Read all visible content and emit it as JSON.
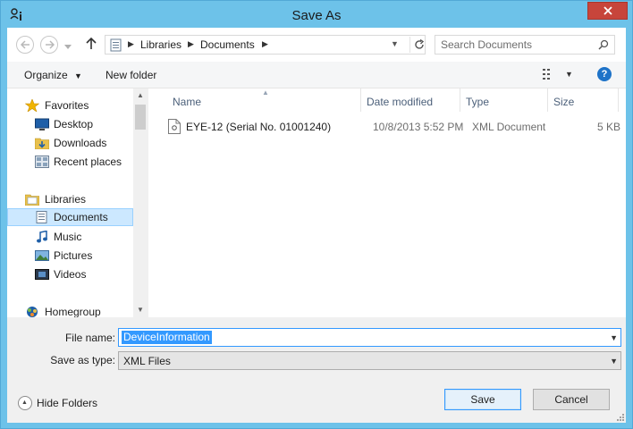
{
  "window": {
    "title": "Save As",
    "close_label": "×"
  },
  "nav": {
    "back": "back",
    "forward": "forward",
    "recent_dropdown": "recent-locations",
    "up": "up"
  },
  "address": {
    "crumbs": [
      "Libraries",
      "Documents"
    ]
  },
  "search": {
    "placeholder": "Search Documents"
  },
  "commandbar": {
    "organize_label": "Organize",
    "new_folder_label": "New folder"
  },
  "navpane": {
    "items": [
      {
        "label": "Favorites",
        "icon": "star-icon",
        "group": true
      },
      {
        "label": "Desktop",
        "icon": "desktop-icon"
      },
      {
        "label": "Downloads",
        "icon": "downloads-folder-icon"
      },
      {
        "label": "Recent places",
        "icon": "recent-places-icon"
      },
      {
        "label": "Libraries",
        "icon": "libraries-icon",
        "group": true
      },
      {
        "label": "Documents",
        "icon": "documents-icon",
        "selected": true
      },
      {
        "label": "Music",
        "icon": "music-icon"
      },
      {
        "label": "Pictures",
        "icon": "pictures-icon"
      },
      {
        "label": "Videos",
        "icon": "videos-icon"
      },
      {
        "label": "Homegroup",
        "icon": "homegroup-icon",
        "group": true
      }
    ]
  },
  "filelist": {
    "columns": [
      "Name",
      "Date modified",
      "Type",
      "Size"
    ],
    "rows": [
      {
        "name": "EYE-12 (Serial No. 01001240)",
        "date_modified": "10/8/2013 5:52 PM",
        "type": "XML Document",
        "size": "5 KB"
      }
    ]
  },
  "form": {
    "file_name_label": "File name:",
    "file_name_value": "DeviceInformation",
    "save_type_label": "Save as type:",
    "save_type_value": "XML Files"
  },
  "footer": {
    "hide_folders_label": "Hide Folders",
    "save_label": "Save",
    "cancel_label": "Cancel"
  },
  "colors": {
    "frame": "#6dc2e9",
    "close": "#c7453b",
    "selection": "#cce8ff",
    "text_selection": "#3399ff",
    "header_text": "#4c607a"
  }
}
